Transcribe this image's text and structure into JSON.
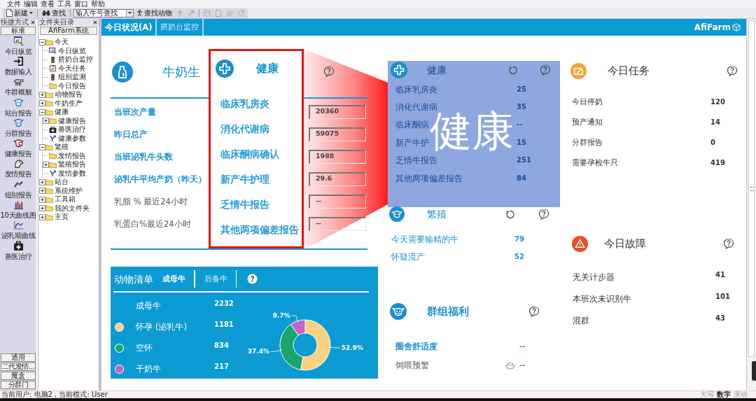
{
  "menu_bar": [
    "文件",
    "编辑",
    "查看",
    "工具",
    "窗口",
    "帮助"
  ],
  "toolbar": {
    "new_button": "新建",
    "find_button": "查找",
    "search": {
      "placeholder": "输入牛号查找"
    },
    "find_animal_button": "查找动物",
    "icon_buttons": [
      {
        "kind": "arrow-up",
        "disabled": true
      },
      {
        "kind": "arrow-up-right",
        "disabled": true
      },
      {
        "kind": "database",
        "disabled": true
      },
      {
        "kind": "document",
        "disabled": true
      },
      {
        "kind": "chain",
        "disabled": true
      },
      {
        "kind": "tag",
        "disabled": true
      }
    ]
  },
  "shortcuts": {
    "title": "快捷方式",
    "group_button": "标准",
    "items": [
      {
        "label": "今日纵览",
        "kind": "overview"
      },
      {
        "label": "数据输入",
        "kind": "input"
      },
      {
        "label": "牛群概貌",
        "kind": "herd"
      },
      {
        "label": "站台报告",
        "kind": "station"
      },
      {
        "label": "分群报告",
        "kind": "group"
      },
      {
        "label": "健康报告",
        "kind": "health"
      },
      {
        "label": "发情报告",
        "kind": "heat"
      },
      {
        "label": "组别报告",
        "kind": "team"
      },
      {
        "label": "10天曲线图",
        "kind": "bars"
      },
      {
        "label": "泌乳期曲线",
        "kind": "curve"
      },
      {
        "label": "兽医治疗",
        "kind": "vet"
      }
    ],
    "bottom_buttons": [
      "通用",
      "二代发情...",
      "魔盒",
      "分群门"
    ]
  },
  "folder_tree": {
    "title": "文件夹目录",
    "root_button": "AfiFarm系统",
    "items": [
      {
        "label": "今天",
        "kind": "folder",
        "expanded": true,
        "children": [
          {
            "label": "今日纵览",
            "kind": "overview"
          },
          {
            "label": "挤奶台监控",
            "kind": "monitor"
          },
          {
            "label": "今天任务",
            "kind": "task"
          },
          {
            "label": "组别监测",
            "kind": "monitor"
          },
          {
            "label": "今日报告",
            "kind": "folder"
          }
        ]
      },
      {
        "label": "动物报告",
        "kind": "folder",
        "expanded": false
      },
      {
        "label": "牛奶生产",
        "kind": "folder",
        "expanded": false
      },
      {
        "label": "健康",
        "kind": "folder",
        "expanded": true,
        "children": [
          {
            "label": "健康报告",
            "kind": "folder",
            "expanded": false
          },
          {
            "label": "兽医治疗",
            "kind": "treatment"
          },
          {
            "label": "健康参数",
            "kind": "parameter"
          }
        ]
      },
      {
        "label": "繁殖",
        "kind": "folder",
        "expanded": true,
        "children": [
          {
            "label": "发情报告",
            "kind": "folder"
          },
          {
            "label": "繁殖报告",
            "kind": "folder",
            "expanded": false
          },
          {
            "label": "发情参数",
            "kind": "parameter"
          }
        ]
      },
      {
        "label": "站台",
        "kind": "folder",
        "expanded": false
      },
      {
        "label": "系统维护",
        "kind": "folder",
        "expanded": false
      },
      {
        "label": "工具箱",
        "kind": "folder",
        "expanded": false
      },
      {
        "label": "我的文件夹",
        "kind": "folder",
        "expanded": false
      },
      {
        "label": "主页",
        "kind": "folder",
        "expanded": false
      }
    ]
  },
  "main_tabs": [
    {
      "label": "今日状况(A)",
      "selected": true
    },
    {
      "label": "挤奶台监控",
      "selected": false
    }
  ],
  "brand": "AfiFarm",
  "milk_production": {
    "title": "牛奶生",
    "rows": [
      {
        "label": "当班次产量",
        "value": "20360",
        "link": true
      },
      {
        "label": "昨日总产",
        "value": "59075",
        "link": true
      },
      {
        "label": "当班泌乳牛头数",
        "value": "1988",
        "link": true
      },
      {
        "label": "泌乳牛平均产奶（昨天）",
        "value": "29.6",
        "link": true
      },
      {
        "label": "乳脂 % 最近24小时",
        "value": "--",
        "link": false
      },
      {
        "label": "乳蛋白%最近24小时",
        "value": "--",
        "link": false
      }
    ]
  },
  "animal_list": {
    "title": "动物清单",
    "tabs": [
      {
        "label": "成母牛",
        "selected": true
      },
      {
        "label": "后备牛",
        "selected": false
      }
    ],
    "rows": [
      {
        "label": "成母牛",
        "value": "2232"
      },
      {
        "label": "怀孕 (泌乳牛)",
        "value": "1181",
        "color": "#f8d27e"
      },
      {
        "label": "空怀",
        "value": "834",
        "color": "#1aa56c"
      },
      {
        "label": "干奶牛",
        "value": "217",
        "color": "#c263c8"
      }
    ],
    "chart_data": {
      "type": "donut",
      "values": [
        52.9,
        37.4,
        9.7
      ],
      "value_labels": [
        "52.9%",
        "37.4%",
        "9.7%"
      ]
    }
  },
  "health": {
    "title": "健康",
    "rows": [
      {
        "label": "临床乳房炎",
        "value": "25"
      },
      {
        "label": "消化代谢病",
        "value": "35"
      },
      {
        "label": "临床酮病",
        "value": "--"
      },
      {
        "label": "新产牛护",
        "value": "15"
      },
      {
        "label": "乏情牛报告",
        "value": "251"
      },
      {
        "label": "其他两项偏差报告",
        "value": "84"
      }
    ]
  },
  "breeding": {
    "title": "繁殖",
    "rows": [
      {
        "label": "今天需要输精的牛",
        "value": "79"
      },
      {
        "label": "怀疑流产",
        "value": "52"
      }
    ]
  },
  "herd_welfare": {
    "title": "群组福利",
    "rows": [
      {
        "label": "圈舍舒适度",
        "value": "--",
        "link": true,
        "kind": "metric"
      },
      {
        "label": "饲喂预警",
        "value": "--",
        "link": false,
        "kind": "feed"
      }
    ]
  },
  "today_tasks": {
    "title": "今日任务",
    "rows": [
      {
        "label": "今日停奶",
        "value": "120"
      },
      {
        "label": "预产通知",
        "value": "14"
      },
      {
        "label": "分群报告",
        "value": "0"
      },
      {
        "label": "需要孕检牛只",
        "value": "419"
      }
    ]
  },
  "today_faults": {
    "title": "今日故障",
    "rows": [
      {
        "label": "无关计步器",
        "value": "41"
      },
      {
        "label": "本班次未识别牛",
        "value": "101"
      },
      {
        "label": "混群",
        "value": "43"
      }
    ]
  },
  "callout": {
    "title": "健康",
    "items": [
      "临床乳房炎",
      "消化代谢病",
      "临床酮病确认",
      "新产牛护理",
      "乏情牛报告",
      "其他两项偏差报告"
    ],
    "caption": "健康"
  },
  "status_bar": {
    "text": "当前用户: 电脑2 , 当前模式: User",
    "indicators": [
      {
        "label": "大写",
        "on": false
      },
      {
        "label": "数字",
        "on": true
      },
      {
        "label": "滚动",
        "on": false
      }
    ]
  }
}
